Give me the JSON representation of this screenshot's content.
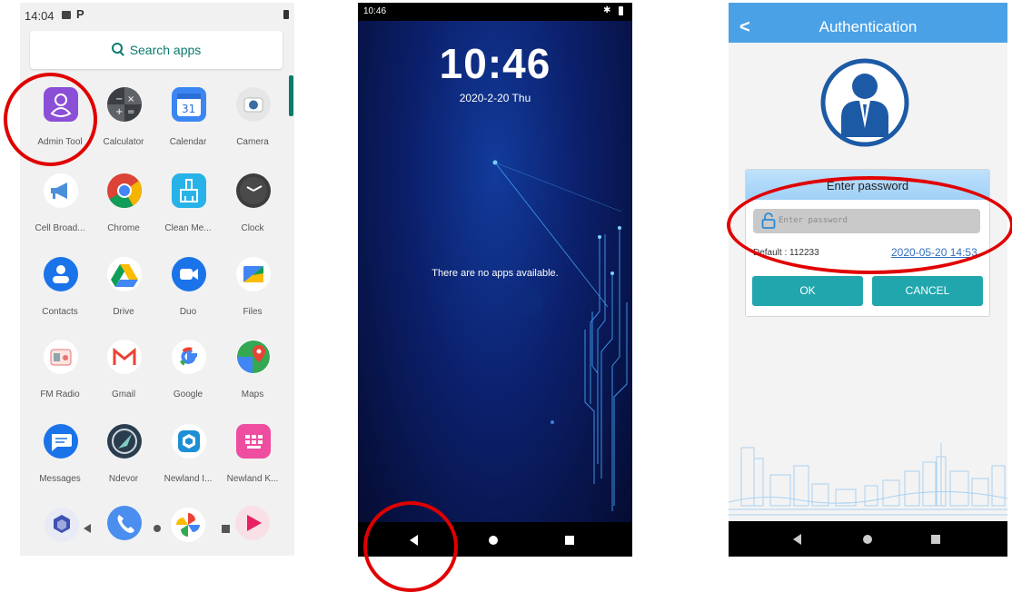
{
  "drawer": {
    "status_time": "14:04",
    "status_p": "P",
    "search_label": "Search apps",
    "apps": [
      {
        "label": "Admin Tool",
        "icon": "admin-tool-icon",
        "color": "#8b4ed6"
      },
      {
        "label": "Calculator",
        "icon": "calculator-icon",
        "color": "#3b3f44"
      },
      {
        "label": "Calendar",
        "icon": "calendar-icon",
        "color": "#3b86f3"
      },
      {
        "label": "Camera",
        "icon": "camera-icon",
        "color": "#e6e6e6"
      },
      {
        "label": "Cell Broad...",
        "icon": "megaphone-icon",
        "color": "#ffffff"
      },
      {
        "label": "Chrome",
        "icon": "chrome-icon",
        "color": "#ffffff"
      },
      {
        "label": "Clean Me...",
        "icon": "broom-icon",
        "color": "#27b3e8"
      },
      {
        "label": "Clock",
        "icon": "clock-icon",
        "color": "#3d3d3d"
      },
      {
        "label": "Contacts",
        "icon": "contacts-icon",
        "color": "#1a73e8"
      },
      {
        "label": "Drive",
        "icon": "drive-icon",
        "color": "#ffffff"
      },
      {
        "label": "Duo",
        "icon": "duo-icon",
        "color": "#1a73e8"
      },
      {
        "label": "Files",
        "icon": "files-icon",
        "color": "#ffffff"
      },
      {
        "label": "FM Radio",
        "icon": "radio-icon",
        "color": "#ffffff"
      },
      {
        "label": "Gmail",
        "icon": "gmail-icon",
        "color": "#ffffff"
      },
      {
        "label": "Google",
        "icon": "google-icon",
        "color": "#ffffff"
      },
      {
        "label": "Maps",
        "icon": "maps-icon",
        "color": "#ffffff"
      },
      {
        "label": "Messages",
        "icon": "messages-icon",
        "color": "#1a73e8"
      },
      {
        "label": "Ndevor",
        "icon": "ndevor-icon",
        "color": "#2a3d4f"
      },
      {
        "label": "Newland I...",
        "icon": "newland-icon",
        "color": "#1e8fd6"
      },
      {
        "label": "Newland K...",
        "icon": "keyboard-icon",
        "color": "#ef4da0"
      }
    ]
  },
  "lock": {
    "status_time": "10:46",
    "clock": "10:46",
    "date": "2020-2-20 Thu",
    "message": "There are no apps available."
  },
  "auth": {
    "title": "Authentication",
    "back": "<",
    "dialog_title": "Enter password",
    "password_placeholder": "Enter password",
    "default_text": "Default : 112233",
    "datetime": "2020-05-20 14:53",
    "ok_label": "OK",
    "cancel_label": "CANCEL"
  },
  "colors": {
    "annotation_red": "#e00000",
    "accent_teal": "#21a6ad",
    "header_blue": "#4aa1e6"
  }
}
